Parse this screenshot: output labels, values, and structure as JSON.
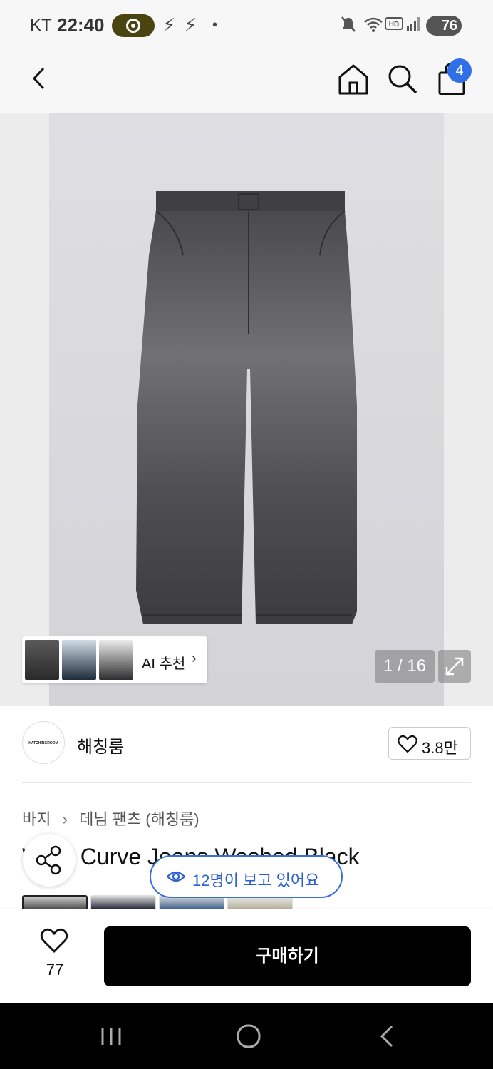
{
  "status_bar": {
    "carrier": "KT",
    "time": "22:40",
    "battery": "76"
  },
  "app_bar": {
    "cart_count": "4"
  },
  "hero": {
    "image_counter": "1 / 16",
    "ai_recommend_label": "AI 추천"
  },
  "brand": {
    "logo_text": "HATCHINGROOM",
    "name": "해칭룸",
    "like_count": "3.8만"
  },
  "breadcrumb": [
    "바지",
    "데님 팬츠 (해칭룸)"
  ],
  "product": {
    "title": "Wide Curve Jeans Washed Black",
    "viewers": "12명이 보고 있어요"
  },
  "bottom_bar": {
    "wish_count": "77",
    "buy_label": "구매하기"
  },
  "colors": {
    "accent": "#2f6fe8",
    "buy_button": "#000000"
  }
}
